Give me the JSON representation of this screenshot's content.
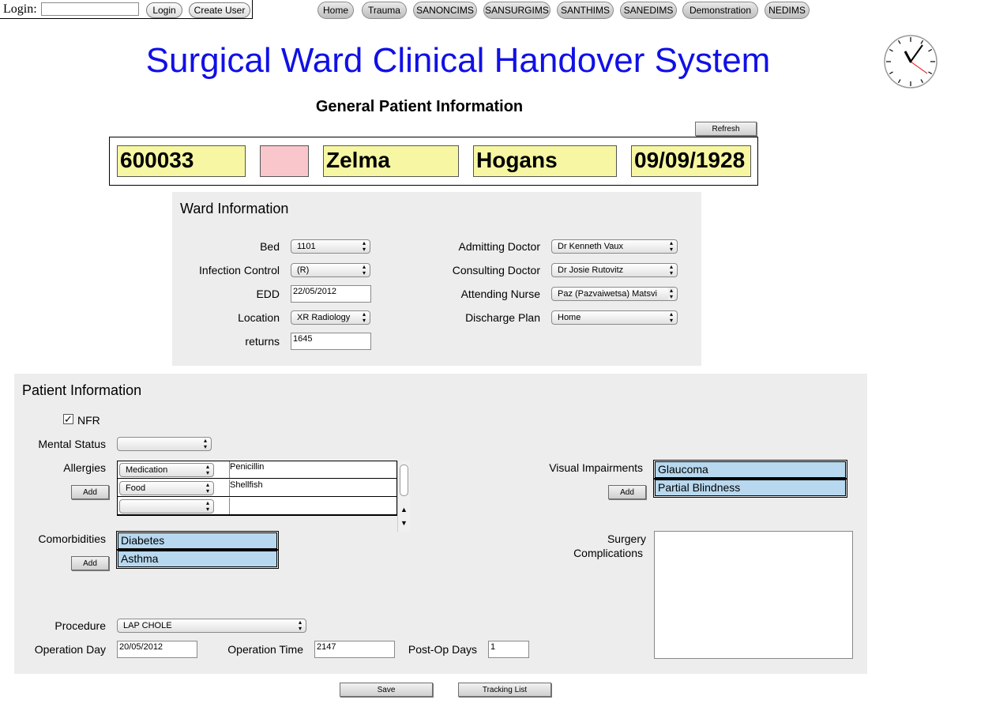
{
  "login": {
    "label": "Login:",
    "value": "",
    "login_button": "Login",
    "create_user_button": "Create User"
  },
  "nav": [
    "Home",
    "Trauma",
    "SANONCIMS",
    "SANSURGIMS",
    "SANTHIMS",
    "SANEDIMS",
    "Demonstration",
    "NEDIMS"
  ],
  "title": "Surgical Ward Clinical Handover System",
  "subtitle": "General Patient Information",
  "refresh_button": "Refresh",
  "patient": {
    "id": "600033",
    "flag": "",
    "first_name": "Zelma",
    "last_name": "Hogans",
    "dob": "09/09/1928",
    "flag_color": "#f9c7cb",
    "field_color": "#f7f7a3"
  },
  "ward": {
    "title": "Ward Information",
    "bed_label": "Bed",
    "bed": "1101",
    "infection_label": "Infection Control",
    "infection": "(R)",
    "edd_label": "EDD",
    "edd": "22/05/2012",
    "location_label": "Location",
    "location": "XR Radiology",
    "returns_label": "returns",
    "returns": "1645",
    "admitting_label": "Admitting Doctor",
    "admitting": "Dr Kenneth Vaux",
    "consulting_label": "Consulting Doctor",
    "consulting": "Dr Josie Rutovitz",
    "nurse_label": "Attending Nurse",
    "nurse": "Paz (Pazvaiwetsa) Matsvi",
    "discharge_label": "Discharge Plan",
    "discharge": "Home"
  },
  "patient_info": {
    "title": "Patient Information",
    "nfr_label": "NFR",
    "nfr_checked": true,
    "mental_label": "Mental Status",
    "mental": "",
    "allergies_label": "Allergies",
    "allergies": [
      {
        "type": "Medication",
        "value": "Penicillin"
      },
      {
        "type": "Food",
        "value": "Shellfish"
      },
      {
        "type": "",
        "value": ""
      }
    ],
    "add_label": "Add",
    "visual_label": "Visual Impairments",
    "visual": [
      "Glaucoma",
      "Partial Blindness"
    ],
    "comorbidities_label": "Comorbidities",
    "comorbidities": [
      "Diabetes",
      "Asthma"
    ],
    "surgery_label_1": "Surgery",
    "surgery_label_2": "Complications",
    "surgery": "",
    "procedure_label": "Procedure",
    "procedure": "LAP CHOLE",
    "op_day_label": "Operation Day",
    "op_day": "20/05/2012",
    "op_time_label": "Operation Time",
    "op_time": "2147",
    "postop_label": "Post-Op Days",
    "postop": "1"
  },
  "save_button": "Save",
  "tracking_button": "Tracking List",
  "colors": {
    "title": "#1010e6",
    "panel": "#ededed",
    "tag": "#b7d8ee"
  }
}
